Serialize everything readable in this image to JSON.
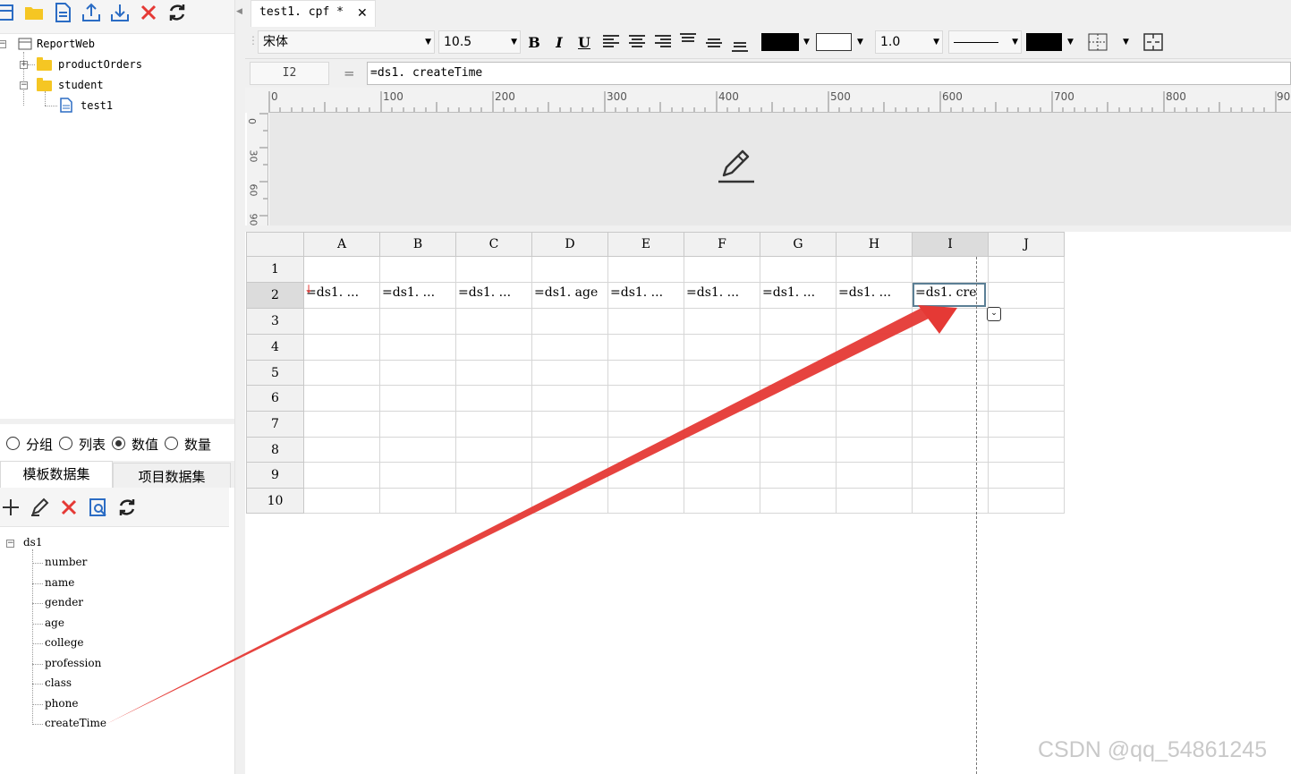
{
  "left_toolbar": {
    "icons": [
      "new-report-icon",
      "folder-icon",
      "document-icon",
      "upload-icon",
      "download-icon",
      "delete-icon",
      "refresh-icon"
    ]
  },
  "report_tree": {
    "root": "ReportWeb",
    "children": [
      {
        "label": "productOrders",
        "expanded": false
      },
      {
        "label": "student",
        "expanded": true,
        "children": [
          "test1"
        ]
      }
    ]
  },
  "dataset_type": {
    "options": [
      "分组",
      "列表",
      "数值",
      "数量"
    ],
    "selected": "数值"
  },
  "dataset_tabs": {
    "template": "模板数据集",
    "project": "项目数据集",
    "active": "模板数据集"
  },
  "dataset_toolbar": {
    "icons": [
      "add-icon",
      "edit-icon",
      "delete-icon",
      "preview-icon",
      "refresh-icon"
    ]
  },
  "dataset_tree": {
    "dataset": "ds1",
    "fields": [
      "number",
      "name",
      "gender",
      "age",
      "college",
      "profession",
      "class",
      "phone",
      "createTime"
    ]
  },
  "editor_tab": {
    "title": "test1. cpf *",
    "close": "✕"
  },
  "format_toolbar": {
    "font_family": "宋体",
    "font_size": "10.5",
    "bold": "B",
    "italic": "I",
    "underline": "U",
    "line_width": "1.0",
    "colors": {
      "font": "#000000",
      "fill": "#ffffff",
      "border": "#000000"
    }
  },
  "formula_bar": {
    "cell_ref": "I2",
    "equals": "=",
    "formula": "=ds1. createTime"
  },
  "ruler": {
    "h_labels": [
      "0",
      "100",
      "200",
      "300",
      "400",
      "500",
      "600",
      "700",
      "800",
      "90"
    ],
    "v_labels": [
      "0",
      "30",
      "60",
      "90"
    ]
  },
  "grid": {
    "columns": [
      "A",
      "B",
      "C",
      "D",
      "E",
      "F",
      "G",
      "H",
      "I",
      "J"
    ],
    "rows": [
      "1",
      "2",
      "3",
      "4",
      "5",
      "6",
      "7",
      "8",
      "9",
      "10"
    ],
    "row2_cells": [
      "=ds1. ...",
      "=ds1. ...",
      "=ds1. ...",
      "=ds1. age",
      "=ds1. ...",
      "=ds1. ...",
      "=ds1. ...",
      "=ds1. ...",
      "=ds1. cre",
      ""
    ],
    "selected_cell": "I2"
  },
  "watermark": "CSDN @qq_54861245"
}
